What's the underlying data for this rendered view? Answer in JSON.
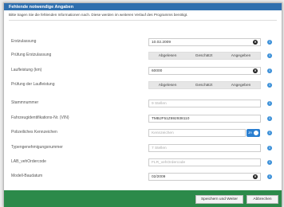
{
  "dialog": {
    "title": "Fehlende notwendige Angaben",
    "intro": "Bitte tragen Sie die fehlenden Informationen nach. Diese werden im weiteren Verlauf des Programms benötigt."
  },
  "fields": {
    "erstzulassung": {
      "label": "Erstzulassung",
      "value": "10.02.2009"
    },
    "pruefung_ez": {
      "label": "Prüfung Erstzulassung",
      "options": [
        "Abgelesen",
        "Geschätzt",
        "Angegeben"
      ]
    },
    "laufleistung": {
      "label": "Laufleistung (km)",
      "value": "60000"
    },
    "pruefung_ll": {
      "label": "Prüfung der Laufleistung",
      "options": [
        "Abgelesen",
        "Geschätzt",
        "Angegeben"
      ]
    },
    "stammnummer": {
      "label": "Stammnummer",
      "placeholder": "9 Stellen"
    },
    "vin": {
      "label": "Fahrzeugidentifikations-Nr. (VIN)",
      "value": "TMBJF51Z692938110"
    },
    "kennzeichen": {
      "label": "Polizeiliches Kennzeichen",
      "placeholder": "Kennzeichen",
      "toggle": "JA"
    },
    "typengenehmigung": {
      "label": "Typengenehmigungsnummer",
      "placeholder": "7 Stellen"
    },
    "lab_code": {
      "label": "LAB_vehOrdercode",
      "placeholder": "FLR_vehOrdercode"
    },
    "modell_baudatum": {
      "label": "Modell-Baudatum",
      "value": "02/2009"
    }
  },
  "footer": {
    "save_label": "Speichern und Weiter",
    "cancel_label": "Abbrechen"
  },
  "icons": {
    "clear": "clear-circle-icon",
    "info": "info-icon"
  },
  "colors": {
    "title_bar": "#2f6fae",
    "footer": "#2c8a4a",
    "accent": "#2b7fd0"
  }
}
